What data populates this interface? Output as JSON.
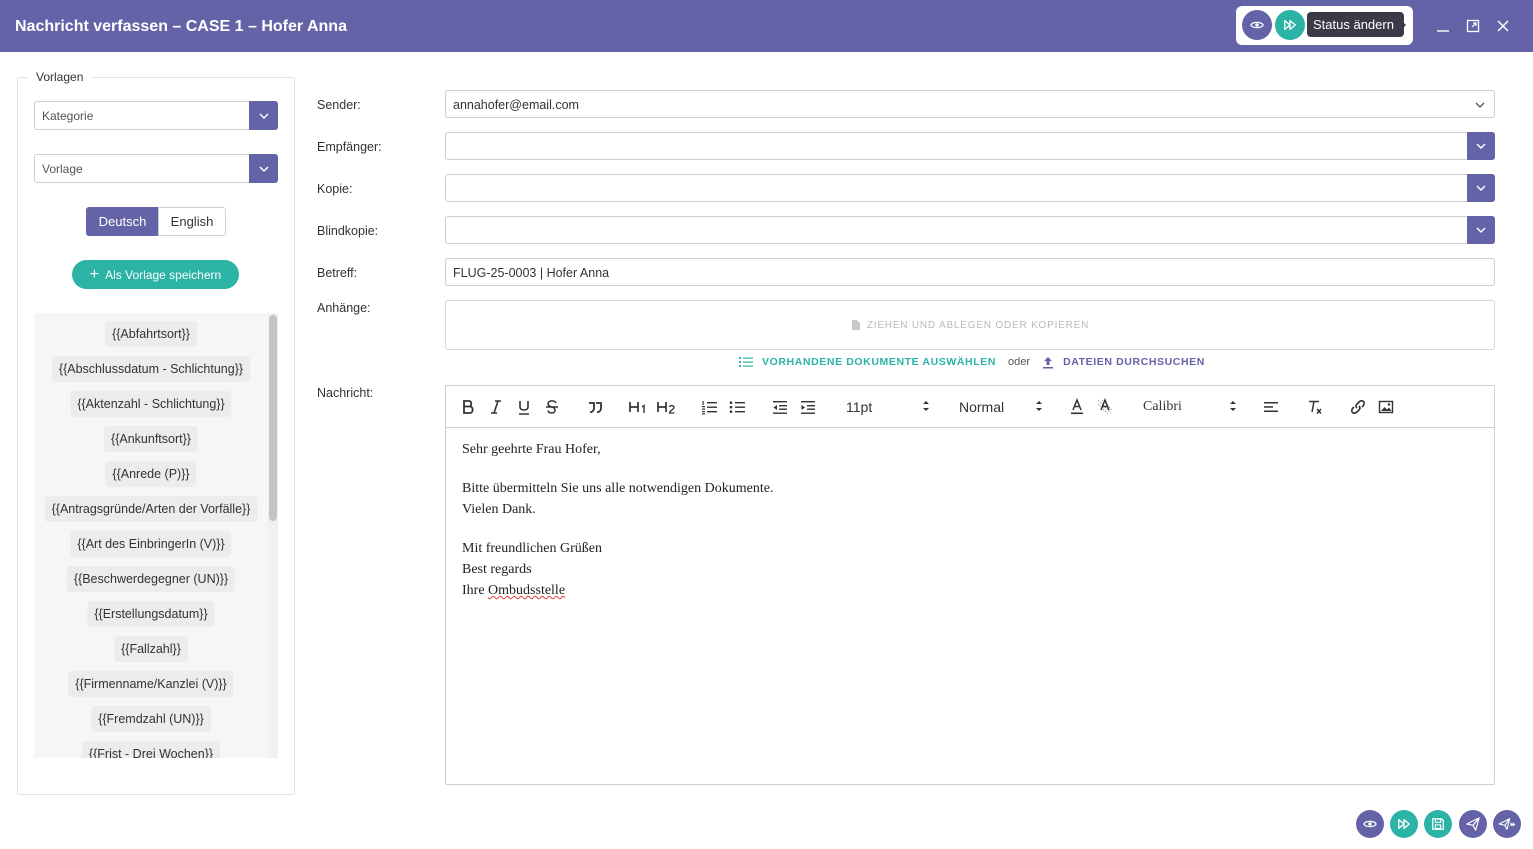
{
  "window": {
    "title": "Nachricht verfassen – CASE 1 – Hofer Anna",
    "tooltip": "Status ändern"
  },
  "templates": {
    "legend": "Vorlagen",
    "category_placeholder": "Kategorie",
    "template_placeholder": "Vorlage",
    "lang_de": "Deutsch",
    "lang_en": "English",
    "save_as_template": "Als Vorlage speichern",
    "placeholders": [
      "{{Abfahrtsort}}",
      "{{Abschlussdatum - Schlichtung}}",
      "{{Aktenzahl - Schlichtung}}",
      "{{Ankunftsort}}",
      "{{Anrede (P)}}",
      "{{Antragsgründe/Arten der Vorfälle}}",
      "{{Art des EinbringerIn (V)}}",
      "{{Beschwerdegegner (UN)}}",
      "{{Erstellungsdatum}}",
      "{{Fallzahl}}",
      "{{Firmenname/Kanzlei (V)}}",
      "{{Fremdzahl (UN)}}",
      "{{Frist - Drei Wochen}}"
    ]
  },
  "form": {
    "sender_label": "Sender:",
    "sender_value": "annahofer@email.com",
    "recipient_label": "Empfänger:",
    "recipient_value": "",
    "cc_label": "Kopie:",
    "cc_value": "",
    "bcc_label": "Blindkopie:",
    "bcc_value": "",
    "subject_label": "Betreff:",
    "subject_value": "FLUG-25-0003 | Hofer Anna",
    "attachments_label": "Anhänge:",
    "dropzone_text": "ZIEHEN UND ABLEGEN ODER KOPIEREN",
    "select_existing": "VORHANDENE DOKUMENTE AUSWÄHLEN",
    "or": "oder",
    "browse_files": "DATEIEN DURCHSUCHEN",
    "message_label": "Nachricht:"
  },
  "editor": {
    "font_size": "11pt",
    "heading": "Normal",
    "font_family": "Calibri",
    "lines": {
      "greeting": "Sehr geehrte Frau Hofer,",
      "body1": "Bitte übermitteln Sie uns alle notwendigen Dokumente.",
      "body2": "Vielen Dank.",
      "closing1": "Mit freundlichen Grüßen",
      "closing2": "Best regards",
      "sign_prefix": "Ihre ",
      "sign_word": "Ombudsstelle"
    }
  },
  "colors": {
    "primary": "#6563a8",
    "accent": "#2bb3a5"
  }
}
